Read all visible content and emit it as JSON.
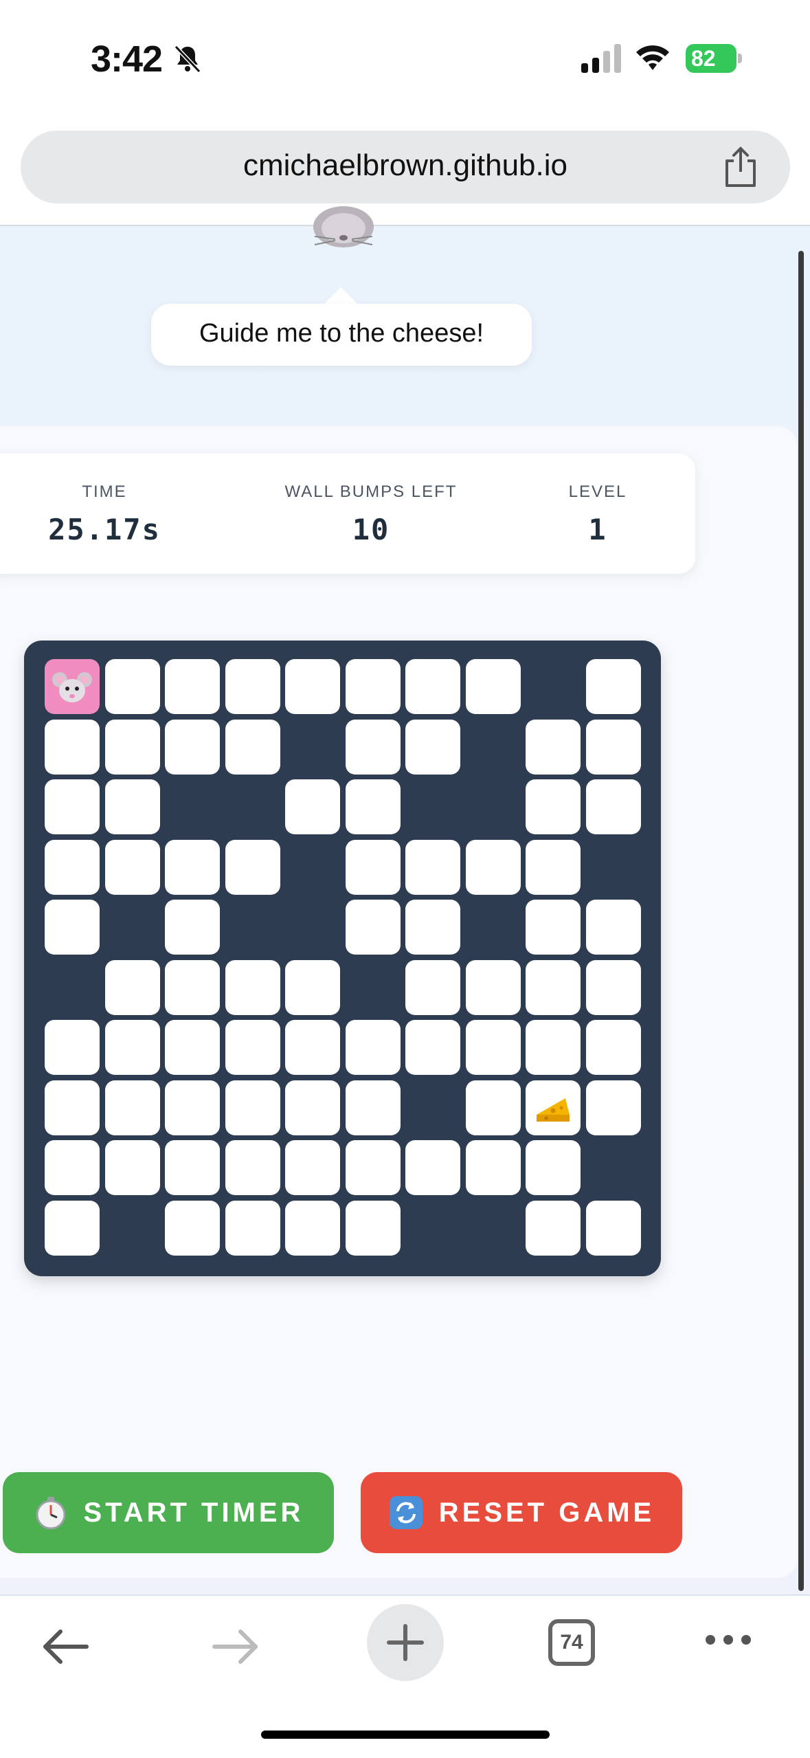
{
  "status_bar": {
    "time": "3:42",
    "battery": "82"
  },
  "browser": {
    "url": "cmichaelbrown.github.io",
    "tabs_count": "74"
  },
  "speech_bubble": "Guide me to the cheese!",
  "stats": {
    "time_label": "TIME",
    "time_value": "25.17s",
    "bumps_label": "WALL BUMPS LEFT",
    "bumps_value": "10",
    "level_label": "LEVEL",
    "level_value": "1"
  },
  "maze": {
    "rows": 10,
    "cols": 10,
    "open_cells": [
      "1111111101",
      "1111011011",
      "1100110011",
      "1111011110",
      "1010011011",
      "0111101111",
      "1111111111",
      "1111110111",
      "1111111110",
      "1011110011"
    ],
    "mouse": [
      0,
      0
    ],
    "cheese": [
      7,
      8
    ]
  },
  "buttons": {
    "start": "START TIMER",
    "reset": "RESET GAME"
  },
  "colors": {
    "start": "#4caf50",
    "reset": "#e74c3c",
    "maze_wall": "#2d3c50",
    "mouse_cell": "#f08cc0"
  }
}
